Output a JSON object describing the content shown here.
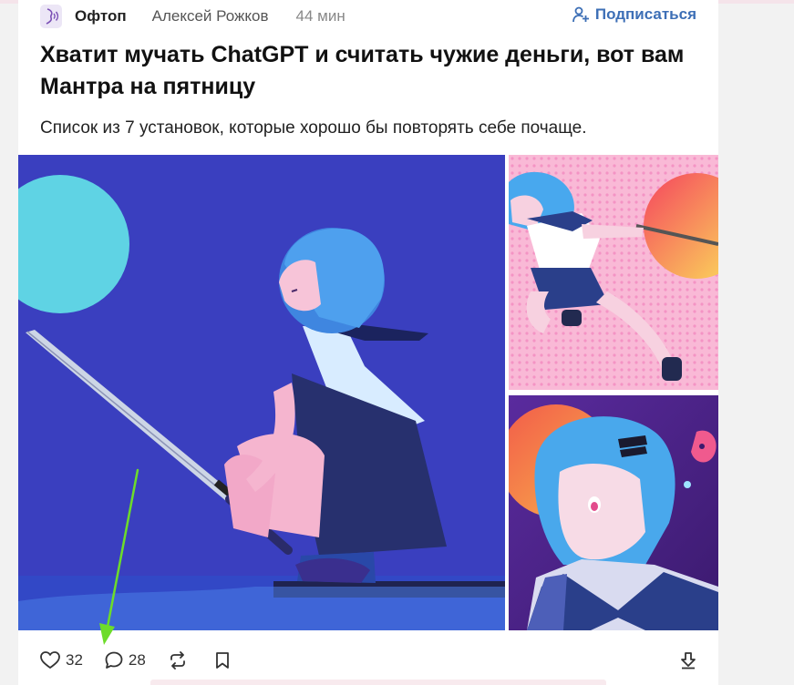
{
  "post": {
    "category": "Офтоп",
    "category_icon": "whisper-icon",
    "author": "Алексей Рожков",
    "time": "44 мин",
    "subscribe_label": "Подписаться",
    "title": "Хватит мучать ChatGPT и считать чужие деньги, вот вам Мантра на пятницу",
    "lead": "Список из 7 установок, которые хорошо бы повторять себе почаще.",
    "images": [
      {
        "name": "anime-girl-with-sword-image"
      },
      {
        "name": "anime-girl-leaping-image"
      },
      {
        "name": "anime-girl-portrait-image"
      }
    ],
    "footer": {
      "likes": "32",
      "comments": "28"
    }
  },
  "colors": {
    "accent": "#3d6fb6",
    "annotation_arrow": "#6ddc2a"
  }
}
